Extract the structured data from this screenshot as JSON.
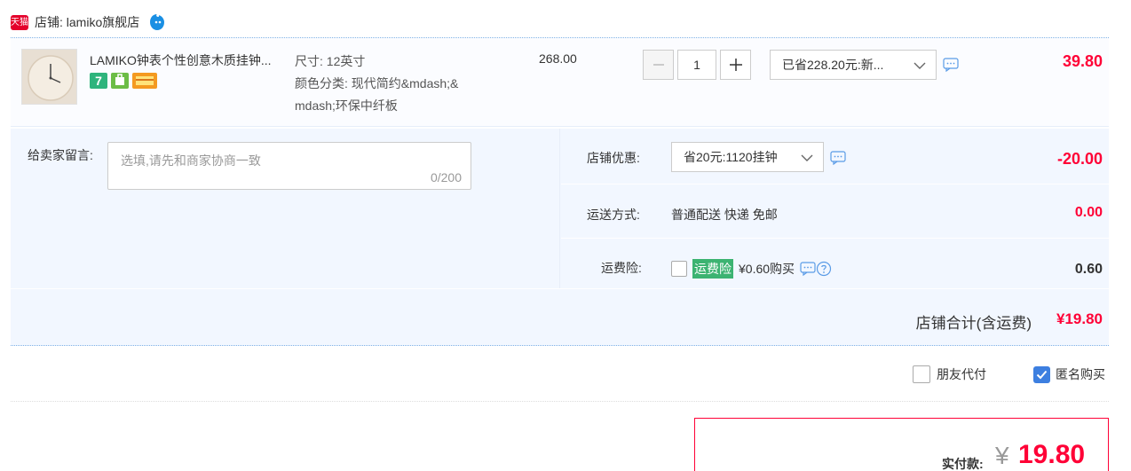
{
  "shop": {
    "badge": "天猫",
    "name": "店铺: lamiko旗舰店"
  },
  "item": {
    "title": "LAMIKO钟表个性创意木质挂钟...",
    "icon_seven": "7",
    "sku_line1": "尺寸: 12英寸",
    "sku_line2": "颜色分类: 现代简约&mdash;&",
    "sku_line3": "mdash;环保中纤板",
    "unit_price": "268.00",
    "quantity": "1",
    "promo_select": "已省228.20元:新...",
    "total": "39.80"
  },
  "order": {
    "message_label": "给卖家留言:",
    "message_placeholder": "选填,请先和商家协商一致",
    "message_count": "0/200",
    "shop_discount_label": "店铺优惠:",
    "shop_discount_select": "省20元:1120挂钟",
    "shop_discount_amount": "-20.00",
    "shipping_label": "运送方式:",
    "shipping_value": "普通配送 快递 免邮",
    "shipping_amount": "0.00",
    "insurance_label": "运费险:",
    "insurance_tag": "运费险",
    "insurance_price": "¥0.60购买",
    "insurance_amount": "0.60",
    "shop_total_label": "店铺合计(含运费)",
    "shop_total_value": "¥19.80"
  },
  "options": {
    "friend_pay": "朋友代付",
    "anonymous": "匿名购买",
    "anonymous_checked": true
  },
  "payment": {
    "label": "实付款:",
    "currency": "¥",
    "amount": "19.80"
  },
  "colors": {
    "accent_red": "#ff0036",
    "checkbox_blue": "#3d7fe0",
    "insurance_green": "#3cb371",
    "panel_bg": "#f2f7ff"
  }
}
